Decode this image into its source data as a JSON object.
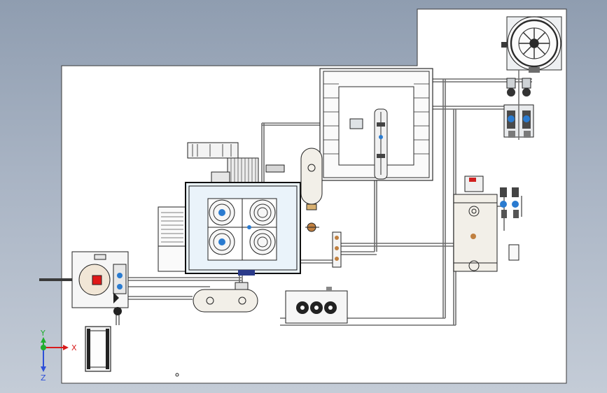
{
  "viewport": {
    "background_top": "#8f9db0",
    "background_bottom": "#c4ccd7",
    "sheet_color": "#ffffff",
    "line_color": "#2b2b2b",
    "pipe_color": "#6d6d6d"
  },
  "triad": {
    "x_label": "X",
    "y_label": "Y",
    "z_label": "Z",
    "x_color": "#d81b1b",
    "y_color": "#1fae2e",
    "z_color": "#2d4fd8"
  },
  "components": [
    {
      "id": "cooling-tower",
      "icon": "fan-icon"
    },
    {
      "id": "chiller-unit",
      "icon": "compressor-icon"
    },
    {
      "id": "condenser-frame",
      "icon": "frame-icon"
    },
    {
      "id": "vertical-receiver",
      "icon": "tank-icon"
    },
    {
      "id": "horizontal-receiver",
      "icon": "tank-icon"
    },
    {
      "id": "boiler-tank",
      "icon": "tank-icon"
    },
    {
      "id": "air-cooler",
      "icon": "fan-icon"
    },
    {
      "id": "pump-station",
      "icon": "pump-icon"
    },
    {
      "id": "motor-unit",
      "icon": "motor-icon"
    }
  ]
}
